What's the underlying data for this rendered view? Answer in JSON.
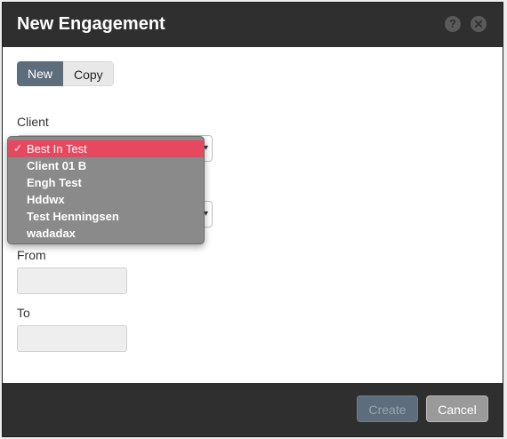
{
  "dialog": {
    "title": "New Engagement"
  },
  "mode_toggle": {
    "new_label": "New",
    "copy_label": "Copy",
    "selected": "New"
  },
  "form": {
    "client_label": "Client",
    "from_label": "From",
    "to_label": "To",
    "from_value": "",
    "to_value": ""
  },
  "client_dropdown": {
    "selected": "Best In Test",
    "options": [
      "Best In Test",
      "Client 01 B",
      "Engh Test",
      "Hddwx",
      "Test Henningsen",
      "wadadax"
    ]
  },
  "footer": {
    "create_label": "Create",
    "cancel_label": "Cancel"
  },
  "colors": {
    "title_bar": "#2f2f2f",
    "selected_option": "#e8485f",
    "toggle_active": "#5e6d7c"
  }
}
